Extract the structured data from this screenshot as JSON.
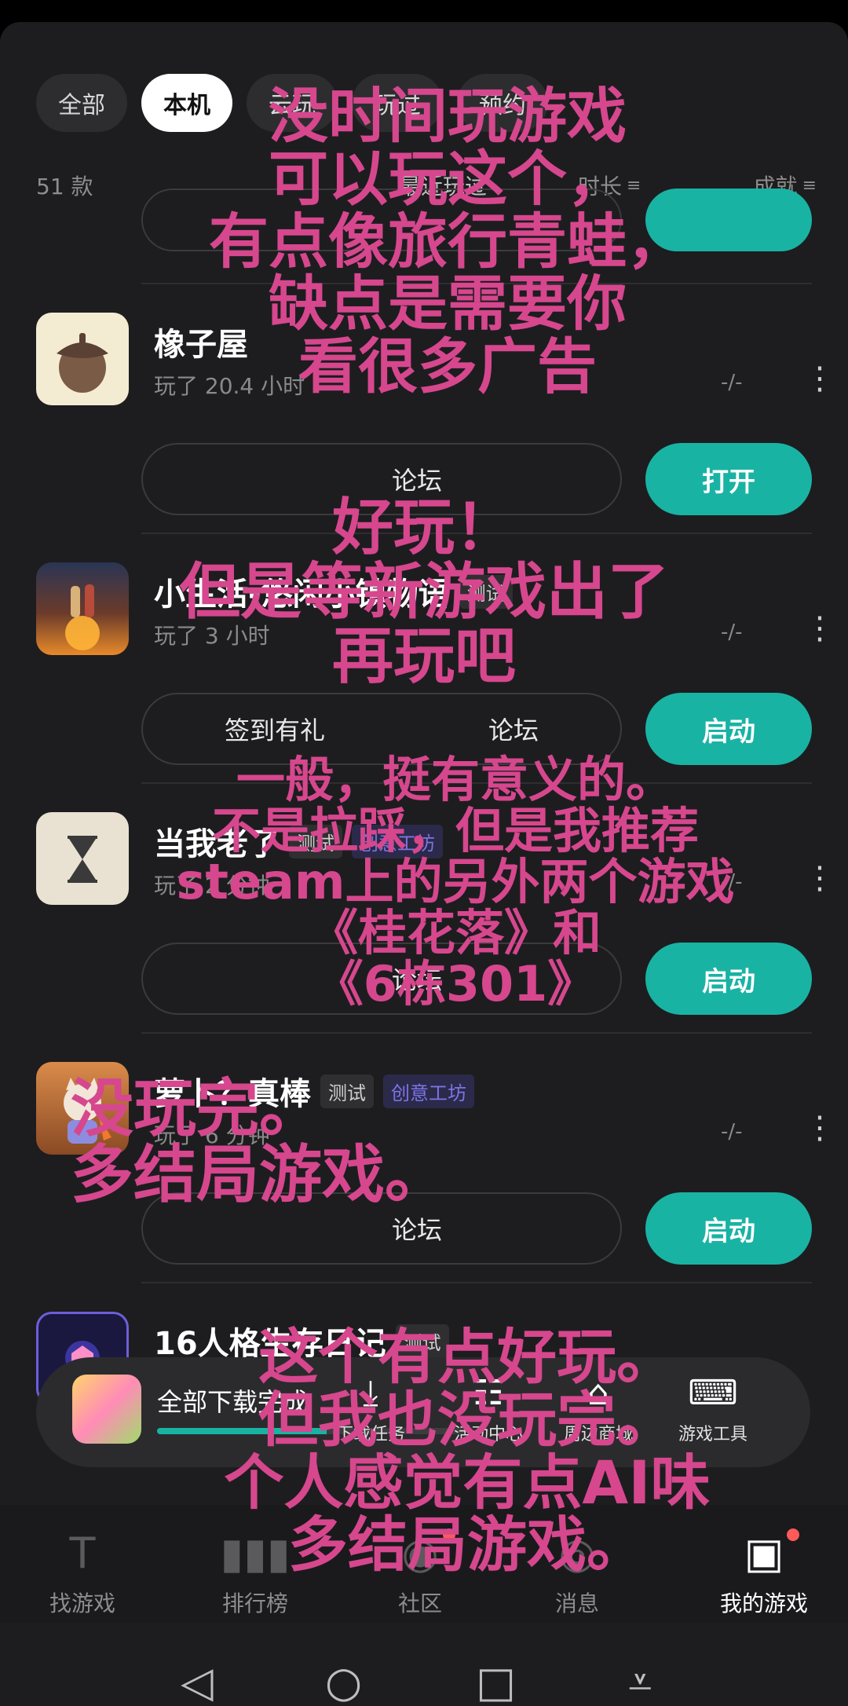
{
  "chips": [
    "全部",
    "本机",
    "云玩",
    "玩过",
    "预约"
  ],
  "active_chip": "本机",
  "sort": {
    "count": "51 款",
    "recent": "最近玩过",
    "duration": "时长",
    "achievement": "成就"
  },
  "games": [
    {
      "title": "橡子屋",
      "tags": [],
      "playtime": "玩了 20.4 小时",
      "score": "-/-",
      "actions": [
        "论坛"
      ],
      "button": "打开"
    },
    {
      "title": "小生活-悠闲小镇物语",
      "tags": [
        "测试"
      ],
      "playtime": "玩了 3 小时",
      "score": "-/-",
      "actions": [
        "签到有礼",
        "论坛"
      ],
      "button": "启动"
    },
    {
      "title": "当我老了",
      "tags": [
        "测试",
        "创意工坊"
      ],
      "playtime": "玩了 2 分钟",
      "score": "-/-",
      "actions": [
        "论坛"
      ],
      "button": "启动"
    },
    {
      "title": "萝卜？真棒",
      "tags": [
        "测试",
        "创意工坊"
      ],
      "playtime": "玩了 6 分钟",
      "score": "-/-",
      "actions": [
        "论坛"
      ],
      "button": "启动"
    },
    {
      "title": "16人格生存日记",
      "tags": [
        "测试"
      ],
      "playtime": "",
      "score": "",
      "actions": [],
      "button": ""
    }
  ],
  "download": {
    "text": "全部下载完成",
    "progress": 0.55,
    "tools": [
      "下载任务",
      "活动中心",
      "周边商城",
      "游戏工具"
    ]
  },
  "nav": [
    "找游戏",
    "排行榜",
    "社区",
    "消息",
    "我的游戏"
  ],
  "nav_active": "我的游戏",
  "captions": [
    "没时间玩游戏\n可以玩这个，\n有点像旅行青蛙，\n缺点是需要你\n看很多广告",
    "好玩！\n但是等新游戏出了\n再玩吧",
    "一般，挺有意义的。\n不是拉踩，但是我推荐\nsteam上的另外两个游戏\n《桂花落》和\n《6栋301》",
    "没玩完。\n多结局游戏。",
    "这个有点好玩。\n但我也没玩完。\n个人感觉有点AI味\n多结局游戏。"
  ],
  "colors": {
    "accent": "#19b3a4",
    "caption": "#d6478e",
    "tag_purple": "#7b74e6"
  }
}
